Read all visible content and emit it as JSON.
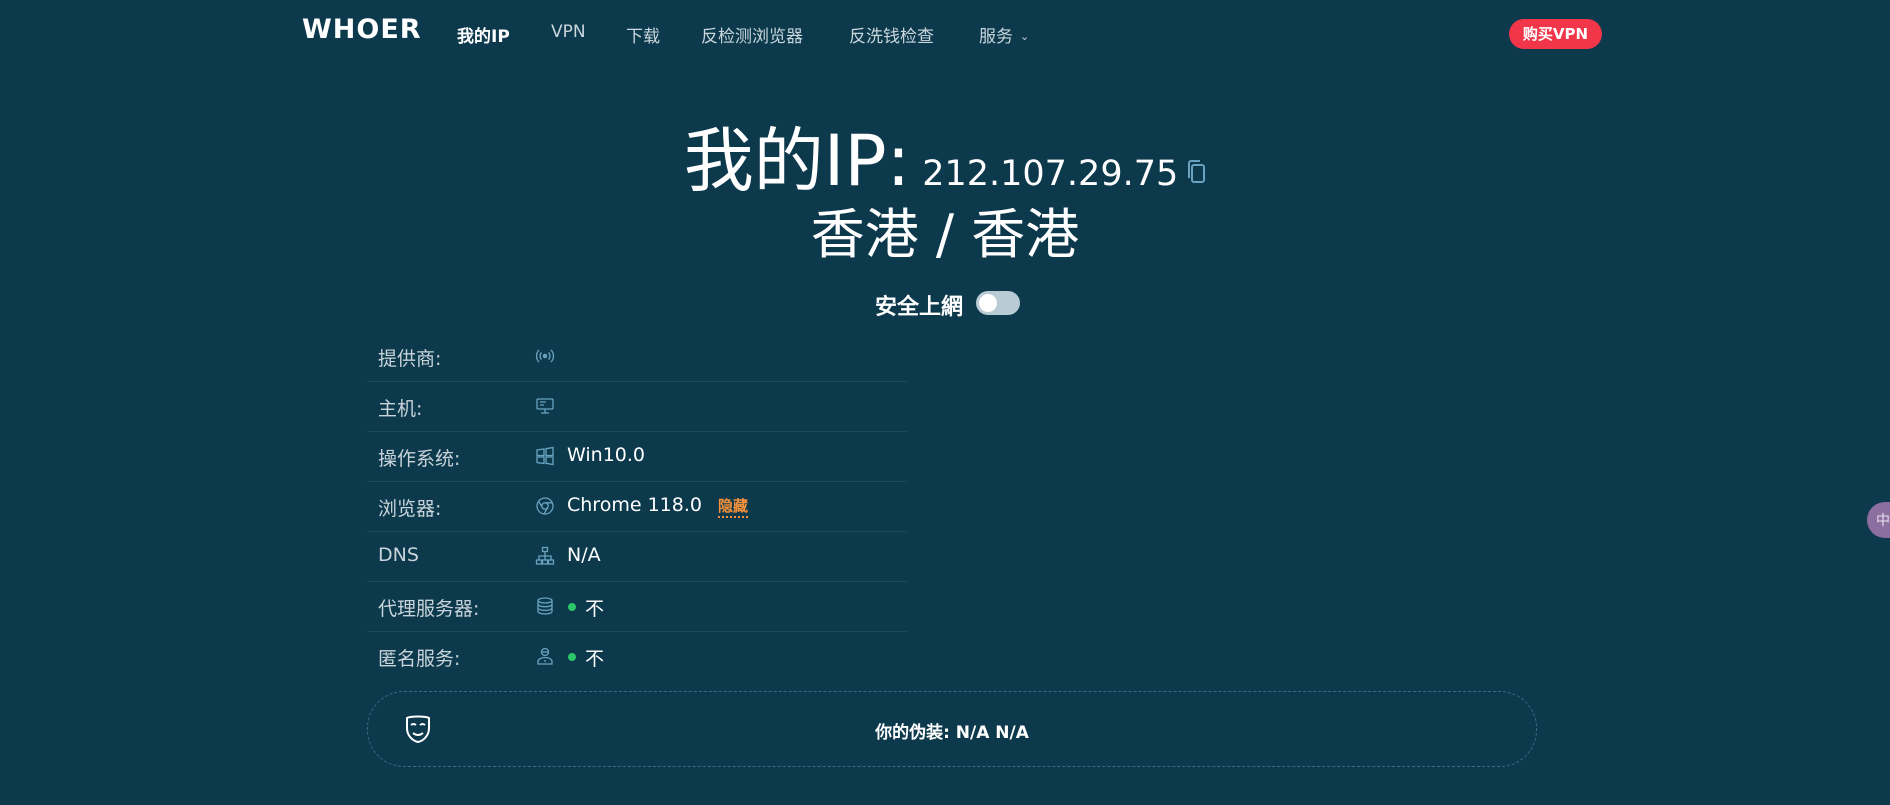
{
  "nav": {
    "logo": "WHOER",
    "items": [
      {
        "label": "我的IP",
        "active": true
      },
      {
        "label": "VPN"
      },
      {
        "label": "下载"
      },
      {
        "label": "反检测浏览器"
      },
      {
        "label": "反洗钱检查"
      },
      {
        "label": "服务",
        "has_dropdown": true
      }
    ],
    "buy_button": "购买VPN"
  },
  "hero": {
    "ip_label": "我的IP:",
    "ip_value": "212.107.29.75",
    "location": "香港 / 香港"
  },
  "secure": {
    "label": "安全上網",
    "enabled": false
  },
  "info_rows": [
    {
      "key": "提供商:",
      "icon": "signal-icon",
      "value": ""
    },
    {
      "key": "主机:",
      "icon": "host-icon",
      "value": ""
    },
    {
      "key": "操作系统:",
      "icon": "windows-icon",
      "value": "Win10.0"
    },
    {
      "key": "浏览器:",
      "icon": "chrome-icon",
      "value": "Chrome 118.0",
      "link": "隐藏"
    },
    {
      "key": "DNS",
      "icon": "network-icon",
      "value": "N/A"
    },
    {
      "key": "代理服务器:",
      "icon": "database-icon",
      "value": "不",
      "status": "ok"
    },
    {
      "key": "匿名服务:",
      "icon": "user-shield-icon",
      "value": "不",
      "status": "ok"
    }
  ],
  "disguise": {
    "text": "你的伪装: N/A  N/A"
  },
  "side_button": "中",
  "colors": {
    "background": "#0c394c",
    "accent_red": "#f2364a",
    "status_green": "#2cc76a",
    "link_orange": "#f5913a",
    "icon_blue": "#6aa3c0"
  }
}
